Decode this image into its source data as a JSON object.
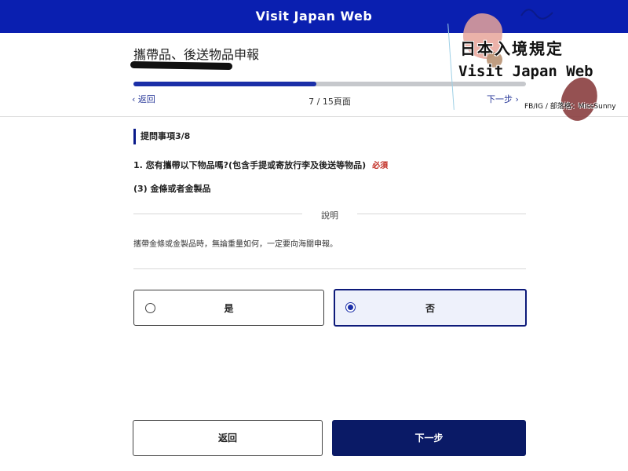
{
  "header": {
    "app_title": "Visit Japan Web"
  },
  "form": {
    "heading": "攜帶品、後送物品申報",
    "progress_fraction": 0.466,
    "nav_back_label": "返回",
    "nav_next_label": "下一步",
    "page_counter": "7 / 15頁面"
  },
  "question": {
    "section_label": "提問事項3/8",
    "text": "1. 您有攜帶以下物品嗎?(包含手提或寄放行李及後送等物品)",
    "required_label": "必須",
    "item_label": "(3) 金條或者金製品"
  },
  "description": {
    "title": "說明",
    "text": "攜帶金條或金製品時，無論重量如何，一定要向海關申報。"
  },
  "options": [
    {
      "label": "是",
      "selected": false
    },
    {
      "label": "否",
      "selected": true
    }
  ],
  "actions": {
    "back_label": "返回",
    "next_label": "下一步"
  },
  "watermark": {
    "line1": "日本入境規定",
    "line2": "Visit Japan Web",
    "line3": "FB/IG / 部落格：MissSunny"
  },
  "colors": {
    "header_bg": "#0a1fb0",
    "primary": "#0a1a66",
    "progress": "#1b2fa8",
    "required": "#c0281e"
  }
}
